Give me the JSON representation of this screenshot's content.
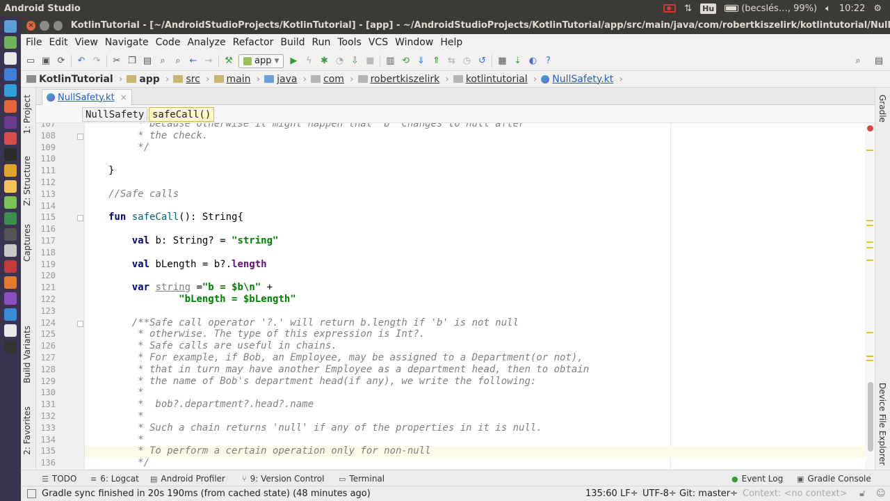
{
  "os_bar": {
    "app_name": "Android Studio",
    "keyboard_layout": "Hu",
    "battery": "(becslés…, 99%)",
    "clock": "10:22"
  },
  "window": {
    "title": "KotlinTutorial - [~/AndroidStudioProjects/KotlinTutorial] - [app] - ~/AndroidStudioProjects/KotlinTutorial/app/src/main/java/com/robertkiszelirk/kotlintutorial/NullSafety.kt"
  },
  "menu": [
    "File",
    "Edit",
    "View",
    "Navigate",
    "Code",
    "Analyze",
    "Refactor",
    "Build",
    "Run",
    "Tools",
    "VCS",
    "Window",
    "Help"
  ],
  "toolbar": {
    "run_config": "app"
  },
  "breadcrumb": [
    "KotlinTutorial",
    "app",
    "src",
    "main",
    "java",
    "com",
    "robertkiszelirk",
    "kotlintutorial",
    "NullSafety.kt"
  ],
  "left_tools": [
    "1: Project",
    "Z: Structure",
    "Captures",
    "Build Variants",
    "2: Favorites"
  ],
  "right_tools": [
    "Gradle",
    "Device File Explorer"
  ],
  "editor": {
    "tab": "NullSafety.kt",
    "structure": [
      "NullSafety",
      "safeCall()"
    ],
    "lines": [
      {
        "n": "107",
        "t": "     * because otherwise it might happen that 'b' changes to null after",
        "c": "cm"
      },
      {
        "n": "108",
        "t": "     * the check.",
        "c": "cm"
      },
      {
        "n": "109",
        "t": "     */",
        "c": "cm"
      },
      {
        "n": "110",
        "t": "",
        "c": ""
      },
      {
        "n": "111",
        "t": "}",
        "c": ""
      },
      {
        "n": "112",
        "t": "",
        "c": ""
      },
      {
        "n": "113",
        "t": "//Safe calls",
        "c": "cm"
      },
      {
        "n": "114",
        "t": "",
        "c": ""
      },
      {
        "n": "115",
        "t": "fun safeCall(): String{",
        "c": "fn"
      },
      {
        "n": "116",
        "t": "",
        "c": ""
      },
      {
        "n": "117",
        "t": "    val b: String? = \"string\"",
        "c": "val-str"
      },
      {
        "n": "118",
        "t": "",
        "c": ""
      },
      {
        "n": "119",
        "t": "    val bLength = b?.length",
        "c": "val-prop"
      },
      {
        "n": "120",
        "t": "",
        "c": ""
      },
      {
        "n": "121",
        "t": "    var string =\"b = $b\\n\" +",
        "c": "var"
      },
      {
        "n": "122",
        "t": "            \"bLength = $bLength\"",
        "c": "str"
      },
      {
        "n": "123",
        "t": "",
        "c": ""
      },
      {
        "n": "124",
        "t": "    /**Safe call operator '?.' will return b.length if 'b' is not null",
        "c": "cm"
      },
      {
        "n": "125",
        "t": "     * otherwise. The type of this expression is Int?.",
        "c": "cm"
      },
      {
        "n": "126",
        "t": "     * Safe calls are useful in chains.",
        "c": "cm"
      },
      {
        "n": "127",
        "t": "     * For example, if Bob, an Employee, may be assigned to a Department(or not),",
        "c": "cm"
      },
      {
        "n": "128",
        "t": "     * that in turn may have another Employee as a department head, then to obtain",
        "c": "cm"
      },
      {
        "n": "129",
        "t": "     * the name of Bob's department head(if any), we write the following:",
        "c": "cm"
      },
      {
        "n": "130",
        "t": "     *",
        "c": "cm"
      },
      {
        "n": "131",
        "t": "     *  bob?.department?.head?.name",
        "c": "cm"
      },
      {
        "n": "132",
        "t": "     *",
        "c": "cm"
      },
      {
        "n": "133",
        "t": "     * Such a chain returns 'null' if any of the properties in it is null.",
        "c": "cm"
      },
      {
        "n": "134",
        "t": "     *",
        "c": "cm"
      },
      {
        "n": "135",
        "t": "     * To perform a certain operation only for non-null",
        "c": "cm"
      },
      {
        "n": "136",
        "t": "     */",
        "c": "cm"
      }
    ]
  },
  "bottom_tools": {
    "todo": "TODO",
    "logcat": "6: Logcat",
    "profiler": "Android Profiler",
    "vcs": "9: Version Control",
    "terminal": "Terminal",
    "event_log": "Event Log",
    "gradle_console": "Gradle Console"
  },
  "status": {
    "message": "Gradle sync finished in 20s 190ms (from cached state) (48 minutes ago)",
    "position": "135:60",
    "line_sep": "LF÷",
    "encoding": "UTF-8÷",
    "git": "Git: master÷",
    "context": "Context: <no context>"
  },
  "colors": {
    "accent": "#2b5fb4",
    "keyword": "#000080",
    "string": "#008000",
    "comment": "#808080"
  }
}
